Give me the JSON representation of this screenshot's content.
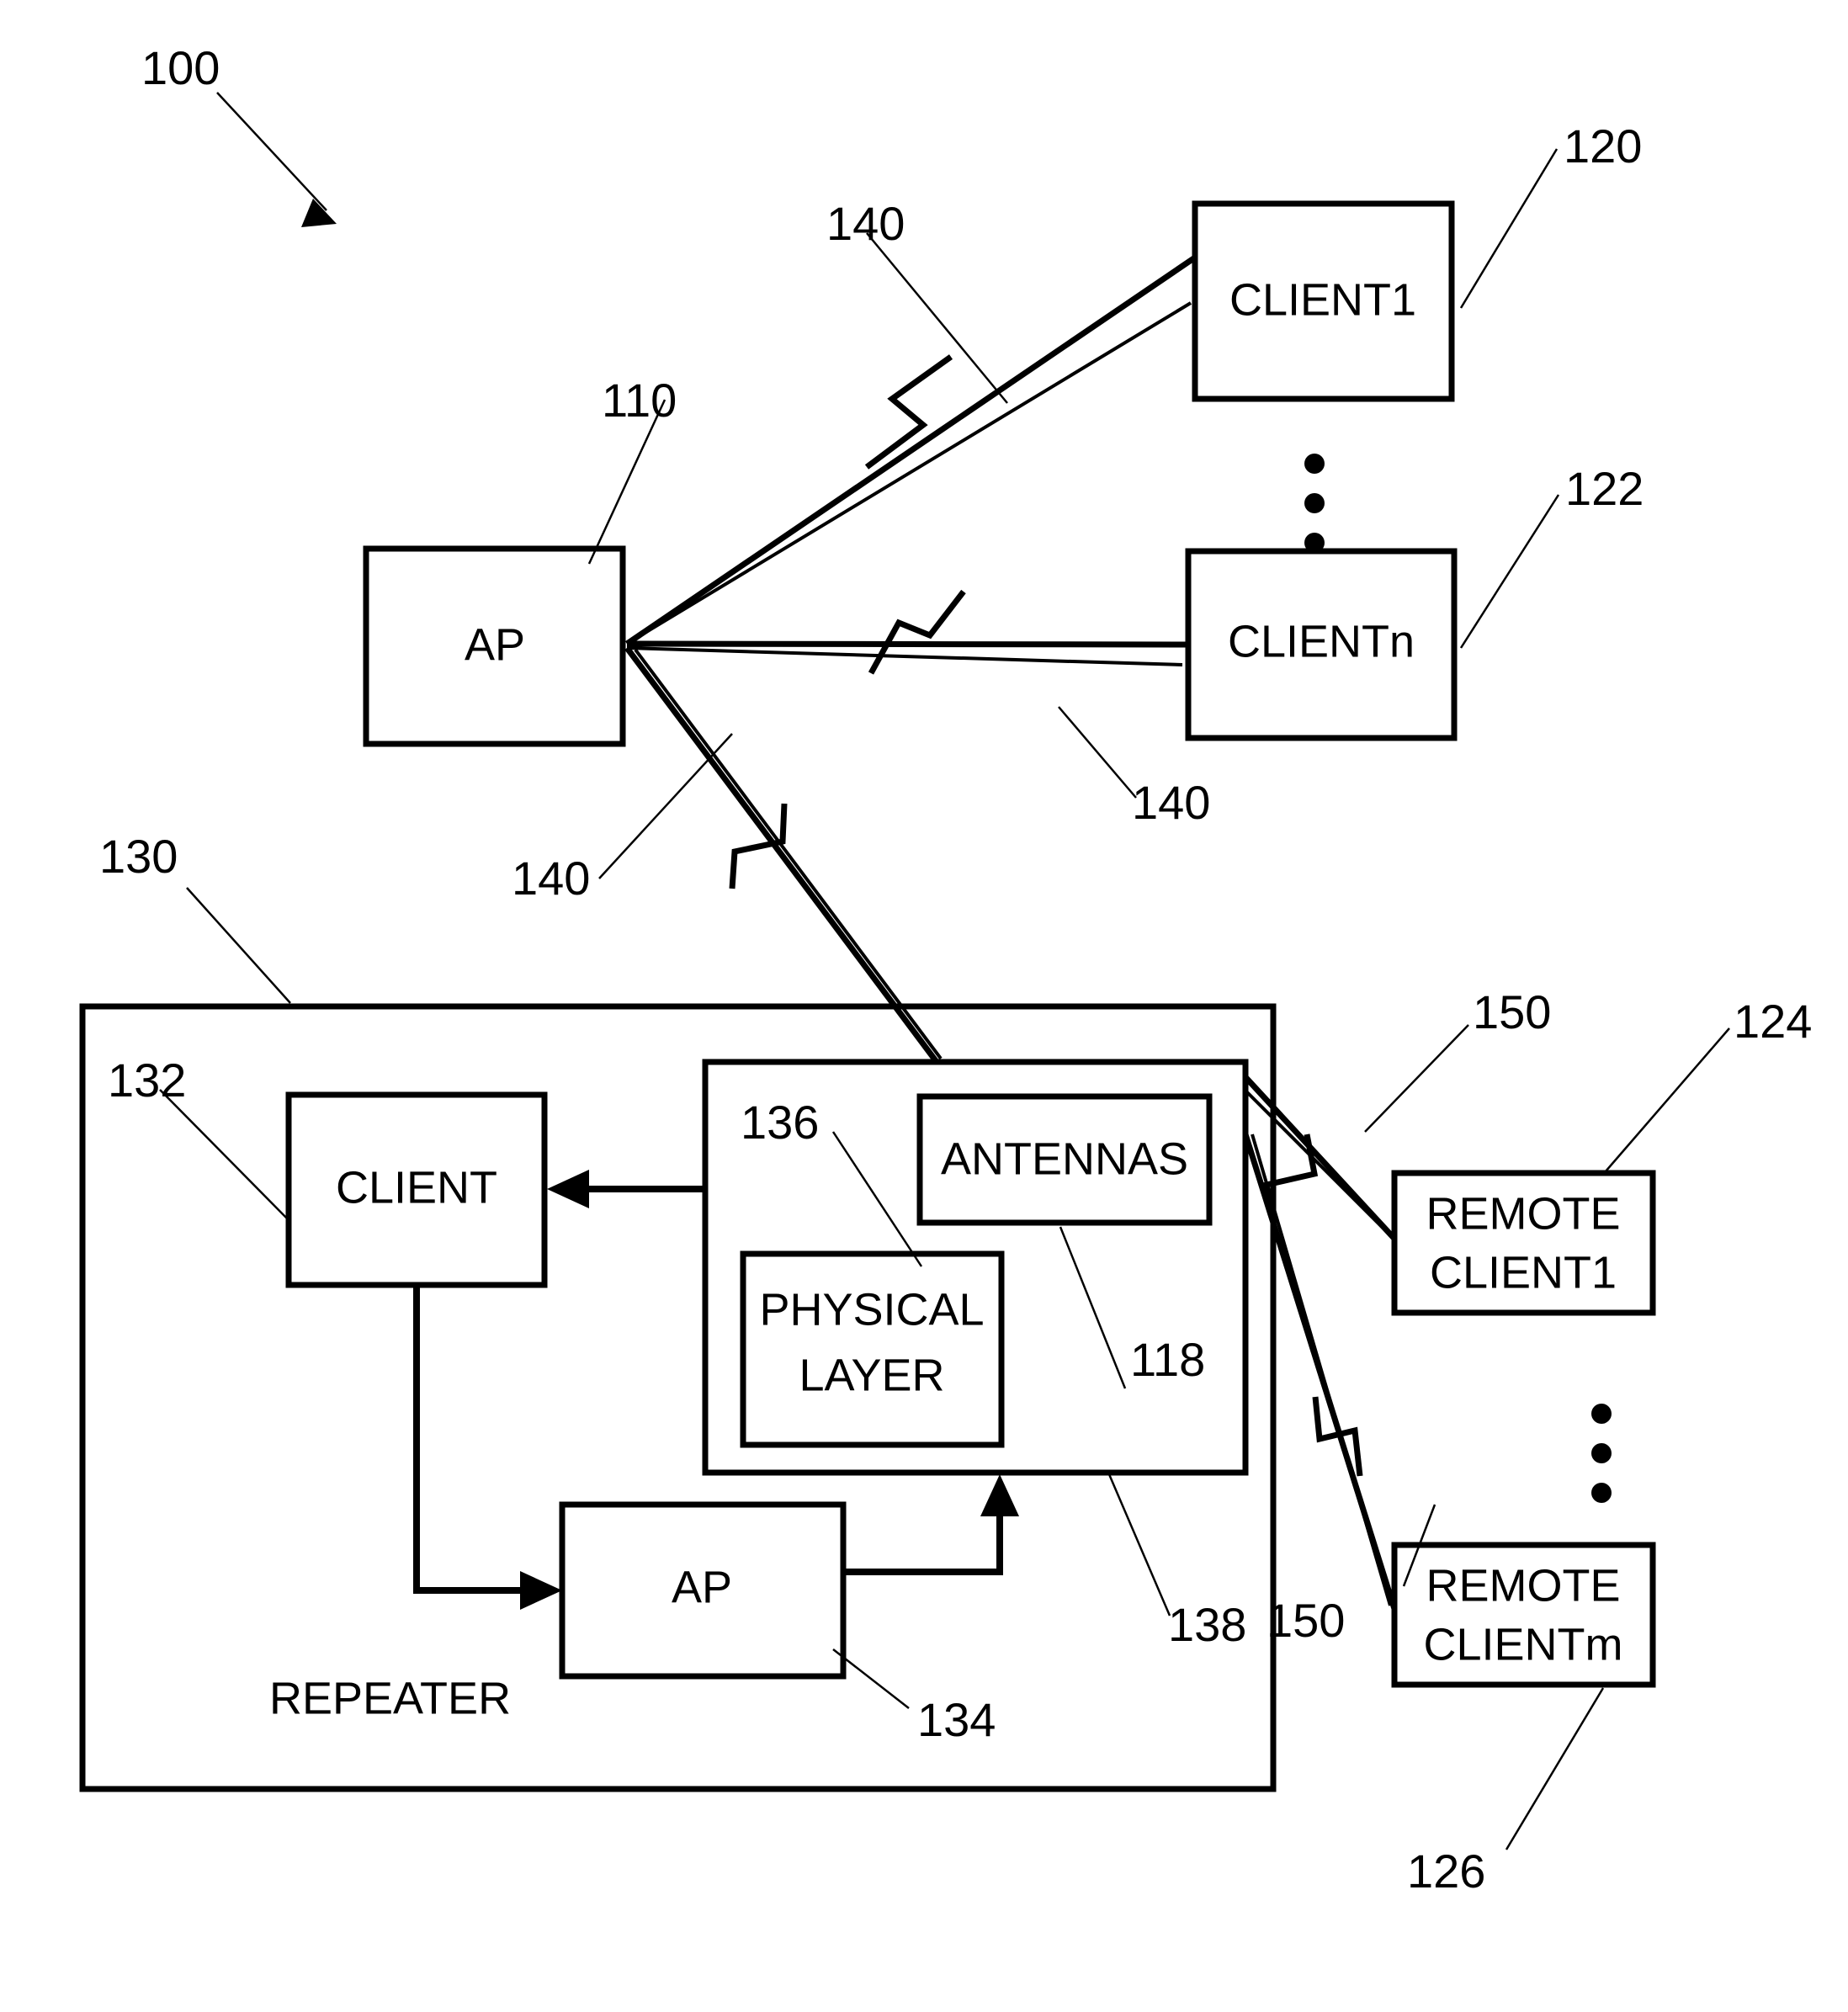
{
  "figure": {
    "system_ref": "100",
    "nodes": [
      {
        "id": "ap",
        "label": "AP",
        "ref": "110"
      },
      {
        "id": "client1",
        "label": "CLIENT1",
        "ref": "120"
      },
      {
        "id": "clientn",
        "label": "CLIENTn",
        "ref": "122"
      },
      {
        "id": "repeater",
        "label": "REPEATER",
        "ref": "130"
      },
      {
        "id": "repeater_client",
        "label": "CLIENT",
        "ref": "132"
      },
      {
        "id": "repeater_ap",
        "label": "AP",
        "ref": "134"
      },
      {
        "id": "physical_layer",
        "label": "PHYSICAL\nLAYER",
        "ref": "136"
      },
      {
        "id": "physical_layer_line1",
        "label": "PHYSICAL",
        "ref": "136"
      },
      {
        "id": "physical_layer_line2",
        "label": "LAYER",
        "ref": "136"
      },
      {
        "id": "antennas",
        "label": "ANTENNAS",
        "ref": "118"
      },
      {
        "id": "transceiver",
        "label": "",
        "ref": "138"
      },
      {
        "id": "remote_client1_line1",
        "label": "REMOTE",
        "ref": "124"
      },
      {
        "id": "remote_client1_line2",
        "label": "CLIENT1",
        "ref": "124"
      },
      {
        "id": "remote_clientm_line1",
        "label": "REMOTE",
        "ref": "126"
      },
      {
        "id": "remote_clientm_line2",
        "label": "CLIENTm",
        "ref": "126"
      }
    ],
    "links": [
      {
        "id": "ap_to_client1",
        "ref": "140"
      },
      {
        "id": "ap_to_clientn",
        "ref": "140"
      },
      {
        "id": "ap_to_repeater",
        "ref": "140"
      },
      {
        "id": "repeater_to_remote1",
        "ref": "150"
      },
      {
        "id": "repeater_to_remotem",
        "ref": "150"
      }
    ],
    "reference_numerals": {
      "system": "100",
      "ap": "110",
      "antennas": "118",
      "client1": "120",
      "clientn": "122",
      "remote_client1": "124",
      "remote_clientm": "126",
      "repeater": "130",
      "repeater_client": "132",
      "repeater_ap": "134",
      "physical_layer": "136",
      "transceiver": "138",
      "ap_client_link": "140",
      "ap_clientn_link": "140",
      "ap_repeater_link": "140",
      "remote_link_upper": "150",
      "remote_link_lower": "150"
    },
    "colors": {
      "ink": "#000000",
      "paper": "#ffffff"
    }
  }
}
